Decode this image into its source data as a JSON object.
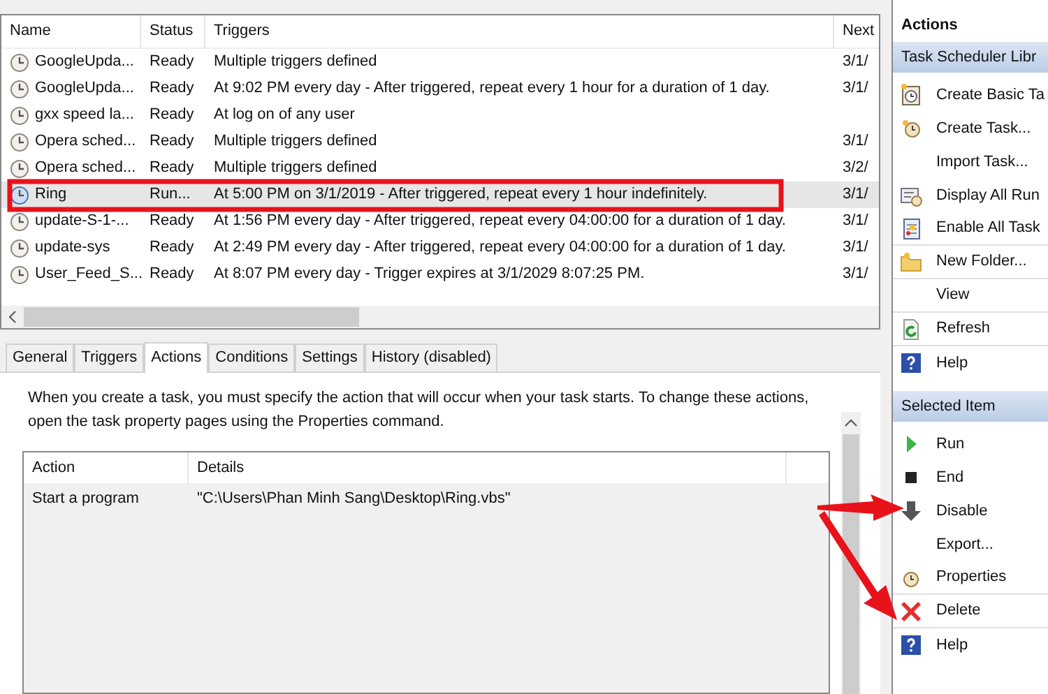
{
  "task_list": {
    "columns": [
      "Name",
      "Status",
      "Triggers",
      "Next"
    ],
    "rows": [
      {
        "name": "GoogleUpda...",
        "status": "Ready",
        "triggers": "Multiple triggers defined",
        "next": "3/1/",
        "selected": false
      },
      {
        "name": "GoogleUpda...",
        "status": "Ready",
        "triggers": "At 9:02 PM every day - After triggered, repeat every 1 hour for a duration of 1 day.",
        "next": "3/1/",
        "selected": false
      },
      {
        "name": "gxx speed la...",
        "status": "Ready",
        "triggers": "At log on of any user",
        "selected": false
      },
      {
        "name": "Opera sched...",
        "status": "Ready",
        "triggers": "Multiple triggers defined",
        "next": "3/1/",
        "selected": false
      },
      {
        "name": "Opera sched...",
        "status": "Ready",
        "triggers": "Multiple triggers defined",
        "next": "3/2/",
        "selected": false
      },
      {
        "name": "Ring",
        "status": "Run...",
        "triggers": "At 5:00 PM on 3/1/2019 - After triggered, repeat every 1 hour indefinitely.",
        "next": "3/1/",
        "selected": true
      },
      {
        "name": "update-S-1-...",
        "status": "Ready",
        "triggers": "At 1:56 PM every day - After triggered, repeat every 04:00:00 for a duration of 1 day.",
        "next": "3/1/",
        "selected": false
      },
      {
        "name": "update-sys",
        "status": "Ready",
        "triggers": "At 2:49 PM every day - After triggered, repeat every 04:00:00 for a duration of 1 day.",
        "next": "3/1/",
        "selected": false
      },
      {
        "name": "User_Feed_S...",
        "status": "Ready",
        "triggers": "At 8:07 PM every day - Trigger expires at 3/1/2029 8:07:25 PM.",
        "next": "3/1/",
        "selected": false
      }
    ]
  },
  "tabs": [
    {
      "label": "General",
      "selected": false
    },
    {
      "label": "Triggers",
      "selected": false
    },
    {
      "label": "Actions",
      "selected": true
    },
    {
      "label": "Conditions",
      "selected": false
    },
    {
      "label": "Settings",
      "selected": false
    },
    {
      "label": "History (disabled)",
      "selected": false
    }
  ],
  "description": "When you create a task, you must specify the action that will occur when your task starts.  To change these actions, open the task property pages using the Properties command.",
  "action_table": {
    "columns": [
      "Action",
      "Details"
    ],
    "rows": [
      {
        "action": "Start a program",
        "details": "\"C:\\Users\\Phan Minh Sang\\Desktop\\Ring.vbs\""
      }
    ]
  },
  "actions_pane": {
    "title": "Actions",
    "sections": [
      {
        "header": "Task Scheduler Libr",
        "items": [
          "Create Basic Ta",
          "Create Task...",
          "Import Task...",
          "Display All Run",
          "Enable All Task",
          "New Folder...",
          "View",
          "Refresh",
          "Help"
        ]
      },
      {
        "header": "Selected Item",
        "items": [
          "Run",
          "End",
          "Disable",
          "Export...",
          "Properties",
          "Delete",
          "Help"
        ]
      }
    ]
  }
}
